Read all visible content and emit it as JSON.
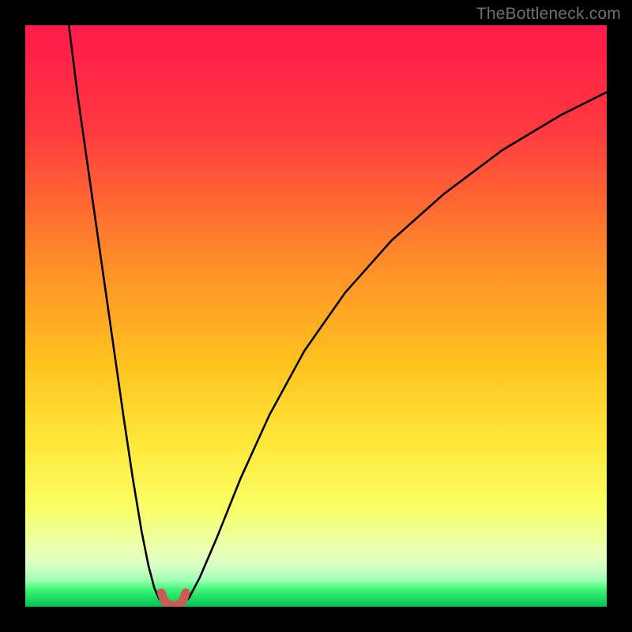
{
  "watermark": "TheBottleneck.com",
  "chart_data": {
    "type": "line",
    "title": "",
    "xlabel": "",
    "ylabel": "",
    "xlim": [
      0,
      100
    ],
    "ylim": [
      0,
      100
    ],
    "grid": false,
    "gradient_stops": [
      {
        "offset": 0,
        "color": "#ff1a4b"
      },
      {
        "offset": 18,
        "color": "#ff3a3f"
      },
      {
        "offset": 40,
        "color": "#ff8a2a"
      },
      {
        "offset": 58,
        "color": "#ffc21f"
      },
      {
        "offset": 72,
        "color": "#ffe83a"
      },
      {
        "offset": 83,
        "color": "#f8ff66"
      },
      {
        "offset": 90,
        "color": "#ecffb0"
      },
      {
        "offset": 93,
        "color": "#d6ffc3"
      },
      {
        "offset": 95.5,
        "color": "#9dffb2"
      },
      {
        "offset": 97,
        "color": "#41f57a"
      },
      {
        "offset": 100,
        "color": "#00c24e"
      }
    ],
    "series": [
      {
        "name": "left-branch",
        "stroke": "#000000",
        "stroke_width": 2.6,
        "x": [
          7.5,
          9,
          11,
          13,
          15,
          17,
          18.5,
          20,
          21.2,
          22.2,
          23,
          23.7
        ],
        "y": [
          100,
          88,
          74,
          60,
          46,
          32,
          22,
          13,
          7,
          3.2,
          1.4,
          0.6
        ]
      },
      {
        "name": "right-branch",
        "stroke": "#000000",
        "stroke_width": 2.6,
        "x": [
          27.3,
          28.2,
          30,
          33,
          37,
          42,
          48,
          55,
          63,
          72,
          82,
          92,
          100
        ],
        "y": [
          0.6,
          1.6,
          5,
          12,
          22,
          33,
          44,
          54,
          63,
          71,
          78.5,
          84.5,
          88.5
        ]
      },
      {
        "name": "highlight-valley",
        "stroke": "#cc5a55",
        "stroke_width": 11,
        "linecap": "round",
        "x": [
          23.4,
          23.9,
          24.7,
          25.5,
          26.3,
          27.1,
          27.6
        ],
        "y": [
          2.4,
          1.0,
          0.3,
          0.2,
          0.3,
          1.0,
          2.4
        ]
      }
    ]
  }
}
